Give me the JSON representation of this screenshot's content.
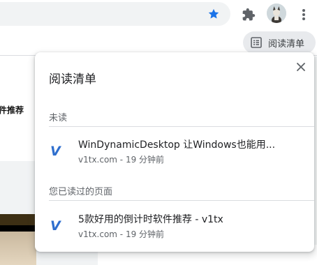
{
  "toolbar": {
    "star_icon": "star-icon",
    "extensions_icon": "puzzle-icon",
    "menu_icon": "vertical-dots-icon",
    "accent_color": "#1a73e8"
  },
  "reading_list_button": {
    "label": "阅读清单",
    "icon": "reading-list-icon"
  },
  "background_page": {
    "snippet": "软件推荐"
  },
  "popup": {
    "title": "阅读清单",
    "unread_header": "未读",
    "read_header": "您已读过的页面",
    "unread": [
      {
        "title": "WinDynamicDesktop 让Windows也能用...",
        "meta": "v1tx.com - 19 分钟前",
        "favicon": "V"
      }
    ],
    "read": [
      {
        "title": "5款好用的倒计时软件推荐 - v1tx",
        "meta": "v1tx.com - 19 分钟前",
        "favicon": "V"
      }
    ],
    "favicon_color": "#2f6fce"
  }
}
